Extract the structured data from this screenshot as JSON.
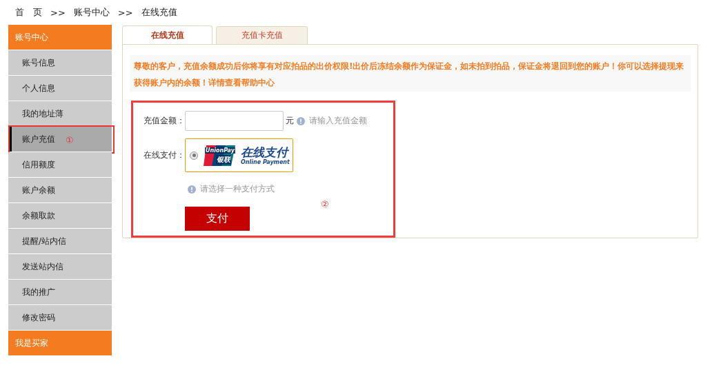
{
  "breadcrumb": [
    "首　页",
    "账号中心",
    "在线充值"
  ],
  "breadcrumb_separator": ">>",
  "sidebar": {
    "header": "账号中心",
    "items": [
      {
        "label": "账号信息",
        "selected": false,
        "highlighted": false
      },
      {
        "label": "个人信息",
        "selected": false,
        "highlighted": false
      },
      {
        "label": "我的地址薄",
        "selected": false,
        "highlighted": false
      },
      {
        "label": "账户充值",
        "selected": true,
        "highlighted": true,
        "annotation": "①"
      },
      {
        "label": "信用额度",
        "selected": false,
        "highlighted": false
      },
      {
        "label": "账户余额",
        "selected": false,
        "highlighted": false
      },
      {
        "label": "余额取款",
        "selected": false,
        "highlighted": false
      },
      {
        "label": "提醒/站内信",
        "selected": false,
        "highlighted": false
      },
      {
        "label": "发送站内信",
        "selected": false,
        "highlighted": false
      },
      {
        "label": "我的推广",
        "selected": false,
        "highlighted": false
      },
      {
        "label": "修改密码",
        "selected": false,
        "highlighted": false
      }
    ],
    "footer": "我是买家"
  },
  "tabs": [
    {
      "label": "在线充值",
      "selected": true
    },
    {
      "label": "充值卡充值",
      "selected": false
    }
  ],
  "notice": "尊敬的客户，充值余额成功后你将享有对应拍品的出价权限!出价后冻结余额作为保证金，如未拍到拍品，保证金将退回到您的账户！你可以选择提现来获得账户内的余额！详情查看帮助中心",
  "form": {
    "highlighted": true,
    "annotation": "②",
    "amount": {
      "label": "充值金额：",
      "unit": "元",
      "hint": "请输入充值金额"
    },
    "payment": {
      "label": "在线支付：",
      "selected": true,
      "logo_text": "UnionPay",
      "logo_cn": "银联",
      "title": "在线支付",
      "subtitle": "Online Payment"
    },
    "payment_hint": "请选择一种支付方式",
    "submit": "支付"
  }
}
